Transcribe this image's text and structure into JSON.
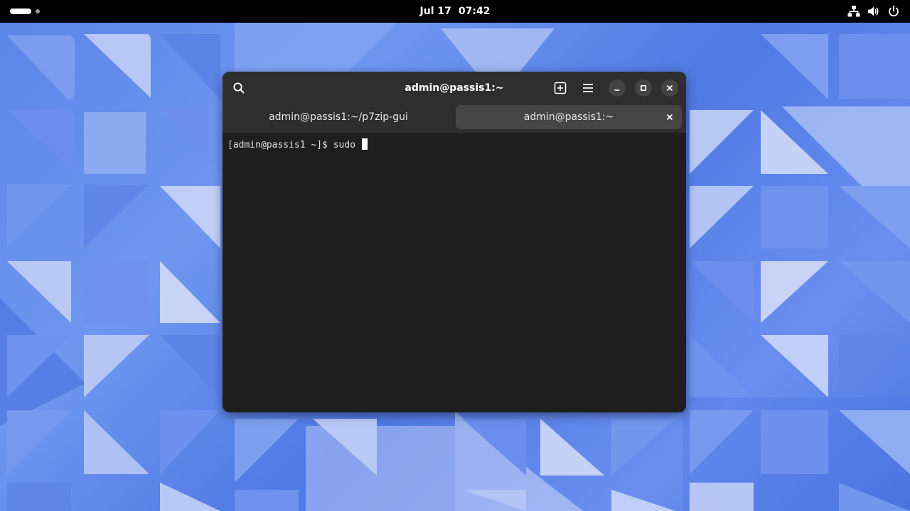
{
  "topbar": {
    "clock_date": "Jul 17",
    "clock_time": "07:42",
    "tray_icons": [
      "network-icon",
      "volume-icon",
      "power-icon"
    ]
  },
  "terminal": {
    "title": "admin@passis1:~",
    "header_icons": [
      "search-icon",
      "new-tab-icon",
      "menu-icon",
      "minimize-icon",
      "maximize-icon",
      "close-icon"
    ],
    "tabs": [
      {
        "label": "admin@passis1:~/p7zip-gui",
        "active": false
      },
      {
        "label": "admin@passis1:~",
        "active": true
      }
    ],
    "prompt": "[admin@passis1 ~]$ ",
    "command": "sudo "
  },
  "colors": {
    "topbar_bg": "#000000",
    "headerbar_bg": "#2e2e2e",
    "terminal_bg": "#1e1e1e",
    "active_tab_bg": "#454545",
    "wallpaper_blue": "#5b84e8"
  }
}
